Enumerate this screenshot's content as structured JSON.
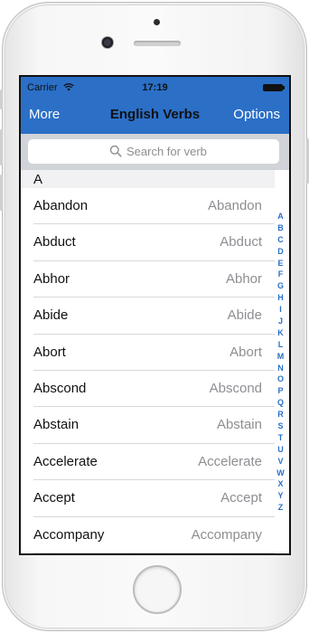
{
  "status": {
    "carrier": "Carrier",
    "time": "17:19"
  },
  "nav": {
    "left": "More",
    "title": "English Verbs",
    "right": "Options"
  },
  "search": {
    "placeholder": "Search for verb"
  },
  "section": {
    "letter": "A"
  },
  "rows": [
    {
      "left": "Abandon",
      "right": "Abandon"
    },
    {
      "left": "Abduct",
      "right": "Abduct"
    },
    {
      "left": "Abhor",
      "right": "Abhor"
    },
    {
      "left": "Abide",
      "right": "Abide"
    },
    {
      "left": "Abort",
      "right": "Abort"
    },
    {
      "left": "Abscond",
      "right": "Abscond"
    },
    {
      "left": "Abstain",
      "right": "Abstain"
    },
    {
      "left": "Accelerate",
      "right": "Accelerate"
    },
    {
      "left": "Accept",
      "right": "Accept"
    },
    {
      "left": "Accompany",
      "right": "Accompany"
    }
  ],
  "index": [
    "A",
    "B",
    "C",
    "D",
    "E",
    "F",
    "G",
    "H",
    "I",
    "J",
    "K",
    "L",
    "M",
    "N",
    "O",
    "P",
    "Q",
    "R",
    "S",
    "T",
    "U",
    "V",
    "W",
    "X",
    "Y",
    "Z"
  ],
  "colors": {
    "accent": "#2b6fc7",
    "searchBar": "#d0d3d8",
    "secondaryText": "#8e8e93"
  },
  "icons": {
    "wifi": "wifi-icon",
    "battery": "battery-icon",
    "search": "search-icon"
  }
}
